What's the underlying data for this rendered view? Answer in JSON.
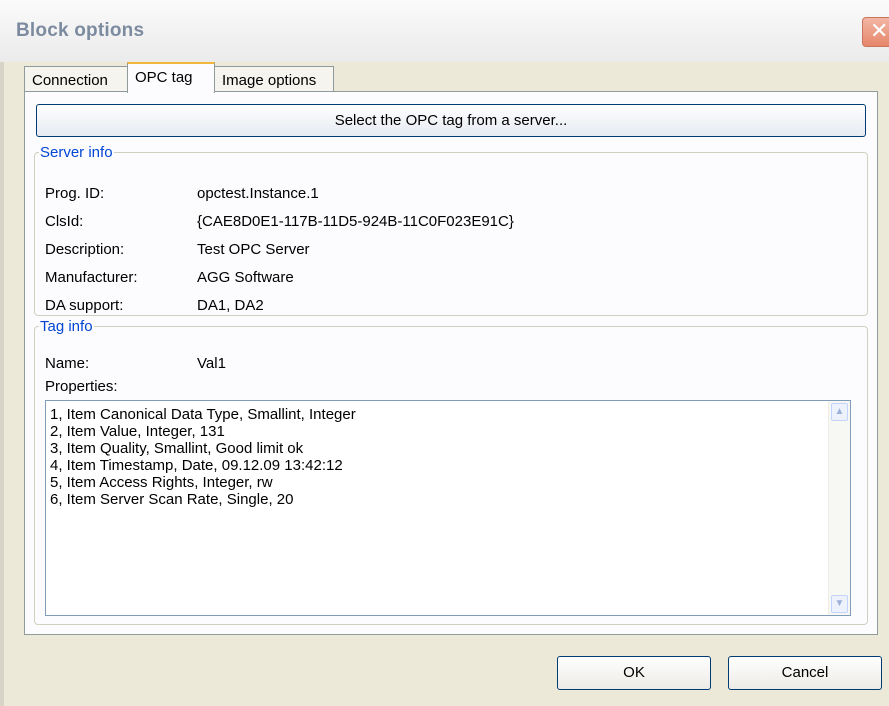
{
  "window": {
    "title": "Block options"
  },
  "tabs": [
    {
      "label": "Connection"
    },
    {
      "label": "OPC tag"
    },
    {
      "label": "Image options"
    }
  ],
  "select_button": {
    "label": "Select the OPC tag from a server..."
  },
  "server_info": {
    "legend": "Server info",
    "rows": [
      {
        "label": "Prog. ID:",
        "value": "opctest.Instance.1"
      },
      {
        "label": "ClsId:",
        "value": "{CAE8D0E1-117B-11D5-924B-11C0F023E91C}"
      },
      {
        "label": "Description:",
        "value": "Test OPC Server"
      },
      {
        "label": "Manufacturer:",
        "value": "AGG Software"
      },
      {
        "label": "DA support:",
        "value": "DA1, DA2"
      }
    ]
  },
  "tag_info": {
    "legend": "Tag info",
    "name_label": "Name:",
    "name_value": "Val1",
    "properties_label": "Properties:",
    "properties": [
      "1, Item Canonical Data Type, Smallint, Integer",
      "2, Item Value, Integer, 131",
      "3, Item Quality, Smallint, Good limit ok",
      "4, Item Timestamp, Date, 09.12.09 13:42:12",
      "5, Item Access Rights, Integer, rw",
      "6, Item Server Scan Rate, Single, 20"
    ]
  },
  "footer": {
    "ok_label": "OK",
    "cancel_label": "Cancel"
  },
  "icons": {
    "close": "close-icon",
    "scroll_up": "scroll-up-icon",
    "scroll_down": "scroll-down-icon"
  },
  "colors": {
    "legend": "#0046d5",
    "active_tab_accent": "#f2b53c",
    "button_border": "#003c74"
  }
}
